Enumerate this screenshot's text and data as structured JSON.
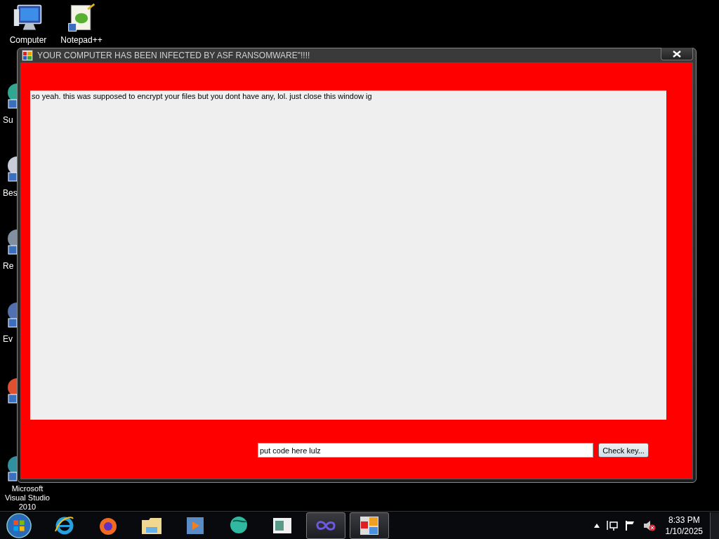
{
  "desktop_icons": [
    {
      "label": "Computer"
    },
    {
      "label": "Notepad++"
    },
    {
      "label": "Su"
    },
    {
      "label": "Bes"
    },
    {
      "label": "Re"
    },
    {
      "label": "Ev"
    },
    {
      "label": "Microsoft Visual Studio 2010"
    }
  ],
  "window": {
    "title": "YOUR COMPUTER HAS BEEN INFECTED BY ASF RANSOMWARE\"!!!!",
    "message": "so yeah. this was supposed to encrypt your files but you dont have any, lol. just close this window ig",
    "key_field": {
      "value": "put code here lulz"
    },
    "button": "Check key..."
  },
  "taskbar": {
    "apps": [
      {
        "active": false
      },
      {
        "active": false
      },
      {
        "active": false
      },
      {
        "active": false
      },
      {
        "active": false
      },
      {
        "active": false
      },
      {
        "active": true
      },
      {
        "active": true
      }
    ],
    "clock": {
      "time": "8:33 PM",
      "date": "1/10/2025"
    }
  }
}
